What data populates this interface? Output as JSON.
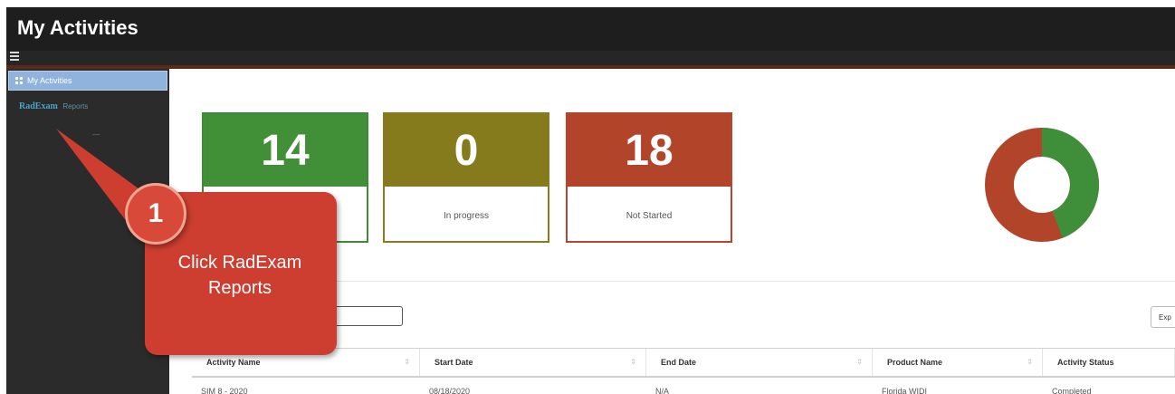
{
  "app": {
    "title": "My Activities"
  },
  "sidebar": {
    "items": [
      {
        "label": "My Activities",
        "icon": "grid-icon",
        "active": true
      },
      {
        "brand": "RadExam",
        "label": "Reports",
        "active": false
      }
    ],
    "dash": "—"
  },
  "stats": [
    {
      "value": "14",
      "label": "",
      "color": "#418f36"
    },
    {
      "value": "0",
      "label": "In progress",
      "color": "#857a1c"
    },
    {
      "value": "18",
      "label": "Not Started",
      "color": "#b2442a"
    }
  ],
  "donut": {
    "green_fraction": 0.44,
    "colors": {
      "green": "#3f8f3a",
      "red": "#b2442a"
    }
  },
  "export_button": {
    "label": "Exp"
  },
  "search": {
    "value": "",
    "placeholder": ""
  },
  "table": {
    "columns": [
      "Activity Name",
      "Start Date",
      "End Date",
      "Product Name",
      "Activity Status"
    ],
    "sort_glyph": "⇕",
    "rows": [
      [
        "SIM 8 - 2020",
        "08/18/2020",
        "N/A",
        "Florida WIDI",
        "Completed"
      ]
    ]
  },
  "callout": {
    "number": "1",
    "line1": "Click RadExam",
    "line2": "Reports"
  }
}
